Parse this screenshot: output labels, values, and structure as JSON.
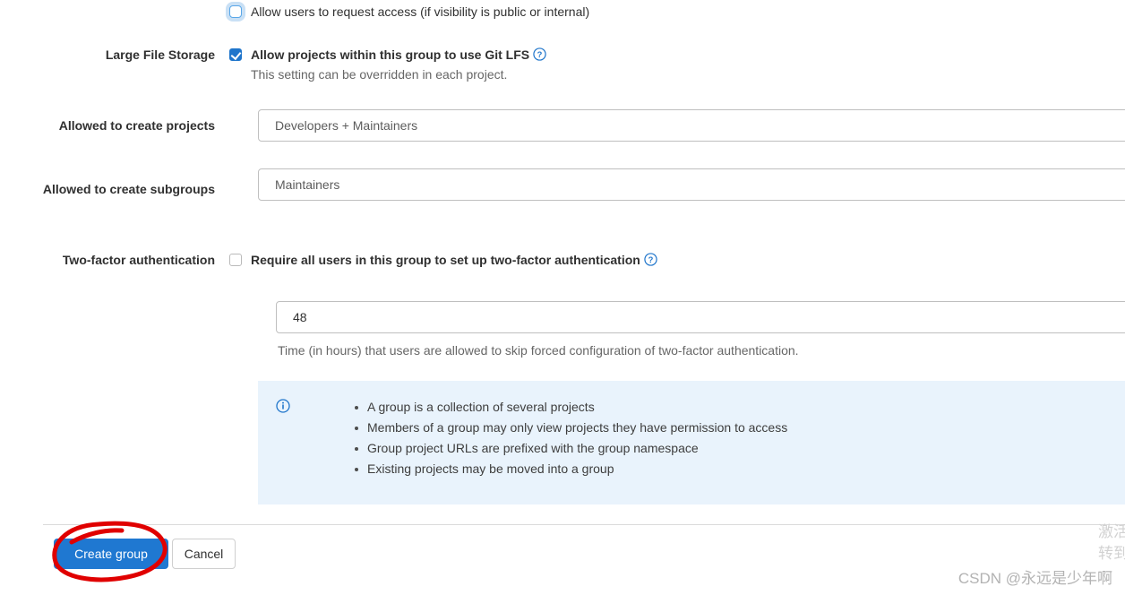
{
  "form": {
    "rows": [
      {
        "label": "",
        "checkbox": {
          "name": "request-access",
          "state": "unchecked-focused",
          "label": "Allow users to request access (if visibility is public or internal)",
          "bold": false
        }
      },
      {
        "label": "Large File Storage",
        "checkbox": {
          "name": "git-lfs",
          "state": "checked",
          "label": "Allow projects within this group to use Git LFS",
          "bold": true,
          "help_icon": "question-circle-icon"
        },
        "helper": "This setting can be overridden in each project."
      },
      {
        "label": "Allowed to create projects",
        "select": {
          "name": "project-creation-level",
          "value": "Developers + Maintainers"
        }
      },
      {
        "label": "Allowed to create subgroups",
        "select": {
          "name": "subgroup-creation-level",
          "value": "Maintainers"
        }
      },
      {
        "label": "Two-factor authentication",
        "checkbox": {
          "name": "require-two-factor",
          "state": "unchecked",
          "label": "Require all users in this group to set up two-factor authentication",
          "bold": true,
          "help_icon": "question-circle-icon"
        }
      }
    ],
    "grace_period": {
      "name": "two-factor-grace-period",
      "value": "48",
      "helper": "Time (in hours) that users are allowed to skip forced configuration of two-factor authentication."
    }
  },
  "info_box": {
    "icon": "info-circle-icon",
    "items": [
      "A group is a collection of several projects",
      "Members of a group may only view projects they have permission to access",
      "Group project URLs are prefixed with the group namespace",
      "Existing projects may be moved into a group"
    ]
  },
  "actions": {
    "submit_label": "Create group",
    "cancel_label": "Cancel"
  },
  "watermarks": {
    "csdn": "CSDN @永远是少年啊",
    "windows_line1": "激活",
    "windows_line2": "转到"
  },
  "colors": {
    "primary": "#1f78d1",
    "checkbox_checked": "#1f75cb",
    "info_bg": "#e9f3fc",
    "info_icon": "#1f75cb",
    "annotation": "#e00000"
  }
}
